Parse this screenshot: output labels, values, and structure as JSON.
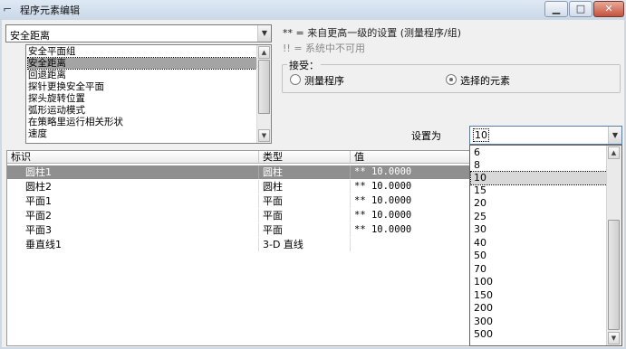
{
  "window": {
    "title": "程序元素编辑",
    "minimize": "▁",
    "maximize": "□",
    "close": "✕"
  },
  "parameter_combo": {
    "value": "安全距离"
  },
  "parameter_list": {
    "items": [
      {
        "label": "安全平面组",
        "selected": false
      },
      {
        "label": "安全距离",
        "selected": true
      },
      {
        "label": "回退距离",
        "selected": false
      },
      {
        "label": "探针更换安全平面",
        "selected": false
      },
      {
        "label": "探头旋转位置",
        "selected": false
      },
      {
        "label": "弧形运动模式",
        "selected": false
      },
      {
        "label": "在策略里运行相关形状",
        "selected": false
      },
      {
        "label": "速度",
        "selected": false
      }
    ]
  },
  "notes": {
    "inherited": "** = 来自更高一级的设置 (测量程序/组)",
    "unavailable": "!! = 系统中不可用"
  },
  "accept_group": {
    "label": "接受：",
    "options": [
      {
        "label": "测量程序",
        "checked": false
      },
      {
        "label": "选择的元素",
        "checked": true
      }
    ]
  },
  "set_as": {
    "label": "设置为",
    "value": "10",
    "options": [
      "6",
      "8",
      "10",
      "15",
      "20",
      "25",
      "30",
      "40",
      "50",
      "70",
      "100",
      "150",
      "200",
      "300",
      "500"
    ],
    "selected_index": 2
  },
  "table": {
    "columns": [
      "标识",
      "类型",
      "值"
    ],
    "rows": [
      {
        "name": "圆柱1",
        "type": "圆柱",
        "value": "** 10.0000",
        "selected": true
      },
      {
        "name": "圆柱2",
        "type": "圆柱",
        "value": "** 10.0000",
        "selected": false
      },
      {
        "name": "平面1",
        "type": "平面",
        "value": "** 10.0000",
        "selected": false
      },
      {
        "name": "平面2",
        "type": "平面",
        "value": "** 10.0000",
        "selected": false
      },
      {
        "name": "平面3",
        "type": "平面",
        "value": "** 10.0000",
        "selected": false
      },
      {
        "name": "垂直线1",
        "type": "3-D 直线",
        "value": "",
        "selected": false
      }
    ]
  }
}
